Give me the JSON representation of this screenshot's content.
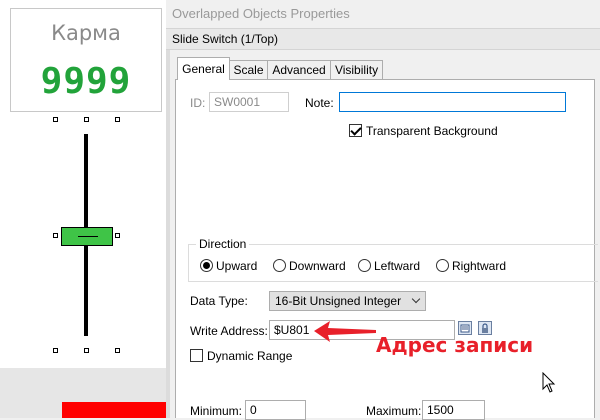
{
  "canvas": {
    "karma_title": "Карма",
    "karma_value": "9999",
    "colors": {
      "digits": "#22a33a",
      "slider_thumb": "#3fc447",
      "bottom_bar": "#ff0000"
    }
  },
  "dialog": {
    "title": "Overlapped Objects Properties",
    "object_label": "Slide Switch (1/Top)",
    "tabs": [
      {
        "label": "General",
        "active": true
      },
      {
        "label": "Scale",
        "active": false
      },
      {
        "label": "Advanced",
        "active": false
      },
      {
        "label": "Visibility",
        "active": false
      }
    ],
    "general": {
      "id_label": "ID:",
      "id_value": "SW0001",
      "note_label": "Note:",
      "note_value": "",
      "transparent_label": "Transparent Background",
      "transparent_checked": true,
      "direction": {
        "legend": "Direction",
        "options": [
          "Upward",
          "Downward",
          "Leftward",
          "Rightward"
        ],
        "selected": "Upward"
      },
      "data_type_label": "Data Type:",
      "data_type_value": "16-Bit Unsigned Integer",
      "write_address_label": "Write Address:",
      "write_address_value": "$U801",
      "dynamic_range_label": "Dynamic Range",
      "dynamic_range_checked": false,
      "minimum_label": "Minimum:",
      "minimum_value": "0",
      "maximum_label": "Maximum:",
      "maximum_value": "1500"
    }
  },
  "annotation": {
    "text": "Адрес записи",
    "color": "#e8202a"
  }
}
